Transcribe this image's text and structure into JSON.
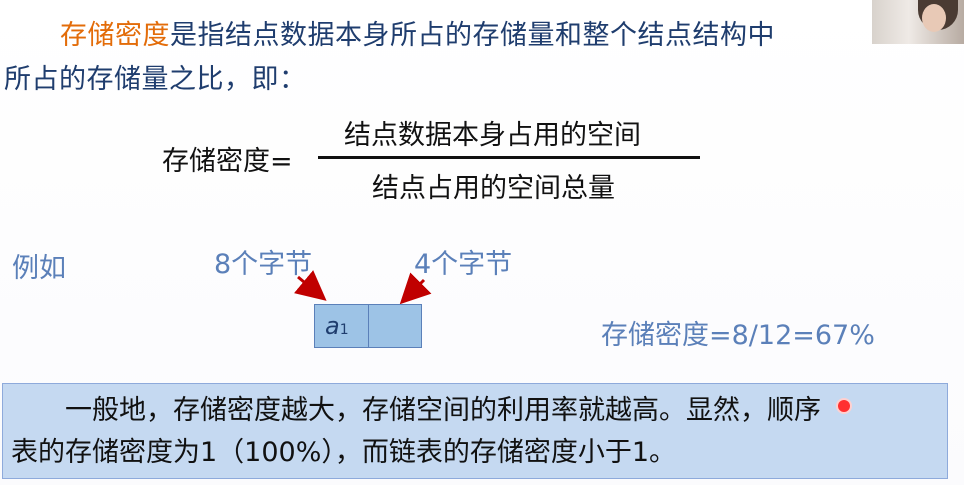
{
  "slide": {
    "intro_highlight": "存储密度",
    "intro_line1_rest": "是指结点数据本身所占的存储量和整个结点结构中",
    "intro_line2": "所占的存储量之比，即：",
    "formula_lhs": "存储密度=",
    "formula_numerator": "结点数据本身占用的空间",
    "formula_denominator": "结点占用的空间总量",
    "example_label": "例如",
    "bytes_label_left": "8个字节",
    "bytes_label_right": "4个字节",
    "node_var": "a",
    "node_sub": "1",
    "result": "存储密度=8/12=67%",
    "summary_line1": "一般地，存储密度越大，存储空间的利用率就越高。显然，顺序",
    "summary_line2": "表的存储密度为1（100%），而链表的存储密度小于1。"
  },
  "colors": {
    "highlight": "#e36c09",
    "label_blue": "#5b80b9",
    "node_fill": "#9dc3e6",
    "bottom_box": "#c5d9f1",
    "arrow_red": "#c00000"
  }
}
